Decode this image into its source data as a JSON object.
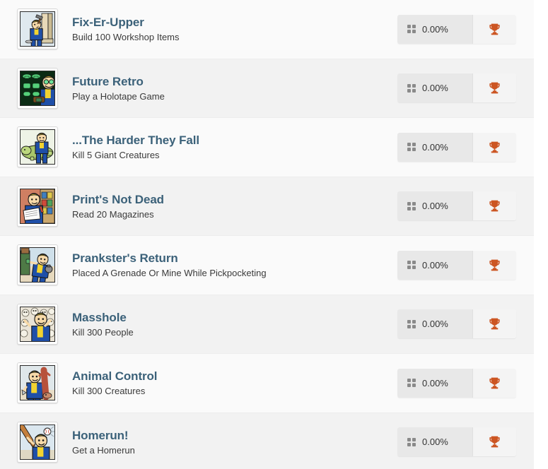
{
  "theme": {
    "title_color": "#3b6179",
    "desc_color": "#3a3a3a",
    "trophy_color": "#cc5522",
    "row_bg_light": "#fafafa",
    "row_bg_dark": "#f2f2f2",
    "progress_bg": "#e8e8e8",
    "trophy_bg": "#f4f4f4"
  },
  "list": {
    "name": "achievements-list",
    "rows": [
      {
        "title": "Fix-Er-Upper",
        "description": "Build 100 Workshop Items",
        "progress": "0.00%",
        "icon": "vault-boy-hammer-icon",
        "trophy": "trophy-icon"
      },
      {
        "title": "Future Retro",
        "description": "Play a Holotape Game",
        "progress": "0.00%",
        "icon": "vault-boy-arcade-game-icon",
        "trophy": "trophy-icon"
      },
      {
        "title": "...The Harder They Fall",
        "description": "Kill 5 Giant Creatures",
        "progress": "0.00%",
        "icon": "vault-boy-fallen-giant-icon",
        "trophy": "trophy-icon"
      },
      {
        "title": "Print's Not Dead",
        "description": "Read 20 Magazines",
        "progress": "0.00%",
        "icon": "vault-boy-reading-magazine-icon",
        "trophy": "trophy-icon"
      },
      {
        "title": "Prankster's Return",
        "description": "Placed A Grenade Or Mine While Pickpocketing",
        "progress": "0.00%",
        "icon": "vault-boy-pickpocket-icon",
        "trophy": "trophy-icon"
      },
      {
        "title": "Masshole",
        "description": "Kill 300 People",
        "progress": "0.00%",
        "icon": "vault-boy-skulls-icon",
        "trophy": "trophy-icon"
      },
      {
        "title": "Animal Control",
        "description": "Kill 300 Creatures",
        "progress": "0.00%",
        "icon": "vault-boy-knife-creature-icon",
        "trophy": "trophy-icon"
      },
      {
        "title": "Homerun!",
        "description": "Get a Homerun",
        "progress": "0.00%",
        "icon": "vault-boy-baseball-bat-icon",
        "trophy": "trophy-icon"
      }
    ]
  }
}
